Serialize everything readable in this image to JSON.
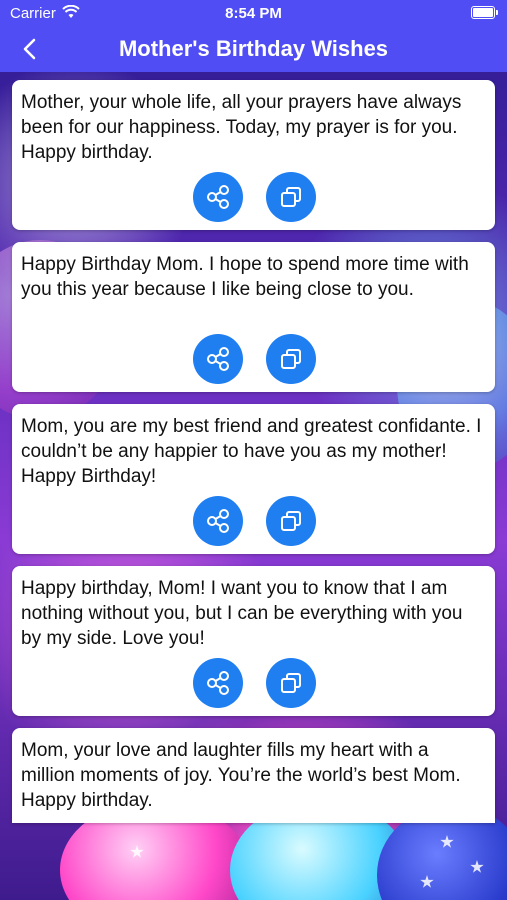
{
  "status_bar": {
    "carrier": "Carrier",
    "time": "8:54 PM"
  },
  "nav": {
    "title": "Mother's Birthday Wishes",
    "back_icon": "chevron-left-icon"
  },
  "wishes": [
    {
      "text": "Mother, your whole life, all your prayers have always been for our happiness. Today, my prayer is for you. Happy birthday."
    },
    {
      "text": "Happy Birthday Mom. I hope to spend more time with you this year because I like being close to you."
    },
    {
      "text": "Mom, you are my best friend and greatest confidante. I couldn’t be any happier to have you as my mother! Happy Birthday!"
    },
    {
      "text": "Happy birthday, Mom! I want you to know that I am nothing without you, but I can be everything with you by my side. Love you!"
    },
    {
      "text": "Mom, your love and laughter fills my heart with a million moments of joy. You’re the world’s best Mom. Happy birthday."
    }
  ],
  "icons": {
    "share": "share-icon",
    "copy": "copy-icon"
  },
  "colors": {
    "bar": "#4f4df3",
    "button": "#1f7ef0",
    "card": "#ffffff"
  }
}
